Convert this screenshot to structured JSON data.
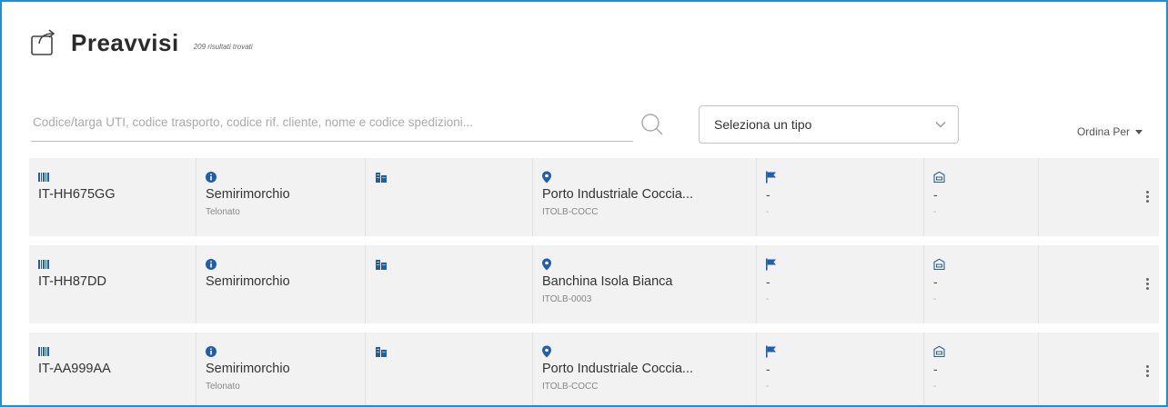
{
  "header": {
    "title": "Preavvisi",
    "subtitle": "209 risultati trovati"
  },
  "search": {
    "placeholder": "Codice/targa UTI, codice trasporto, codice rif. cliente, nome e codice spedizioni...",
    "value": ""
  },
  "type_select": {
    "label": "Seleziona un tipo"
  },
  "sort": {
    "label": "Ordina Per"
  },
  "colors": {
    "accent": "#1e8fd0",
    "icon_blue": "#1f5fa8",
    "row_bg": "#f2f2f2"
  },
  "rows": [
    {
      "plate": "IT-HH675GG",
      "type": "Semirimorchio",
      "subtype": "Telonato",
      "location": "Porto Industriale Coccia...",
      "location_code": "ITOLB-COCC",
      "flag_main": "-",
      "flag_sub": "-",
      "box_main": "-",
      "box_sub": "-"
    },
    {
      "plate": "IT-HH87DD",
      "type": "Semirimorchio",
      "subtype": "",
      "location": "Banchina Isola Bianca",
      "location_code": "ITOLB-0003",
      "flag_main": "-",
      "flag_sub": "-",
      "box_main": "-",
      "box_sub": "-"
    },
    {
      "plate": "IT-AA999AA",
      "type": "Semirimorchio",
      "subtype": "Telonato",
      "location": "Porto Industriale Coccia...",
      "location_code": "ITOLB-COCC",
      "flag_main": "-",
      "flag_sub": "-",
      "box_main": "-",
      "box_sub": "-"
    }
  ]
}
